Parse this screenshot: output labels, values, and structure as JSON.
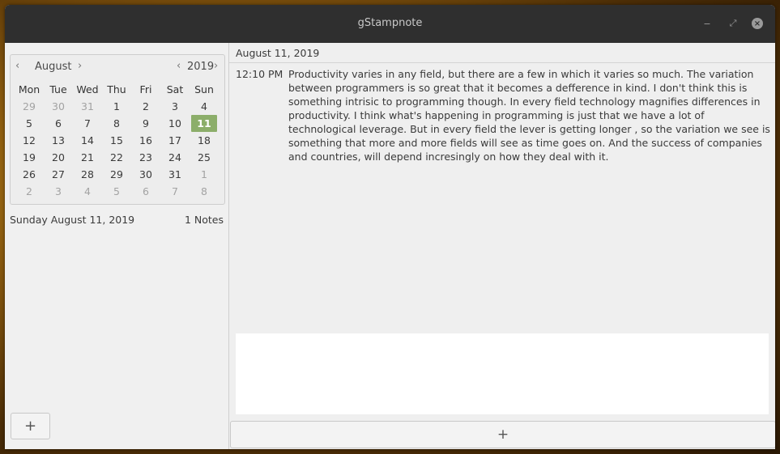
{
  "window": {
    "title": "gStampnote",
    "controls": {
      "minimize": "−",
      "maximize": "⤢",
      "close": "×"
    }
  },
  "calendar": {
    "month": "August",
    "year": "2019",
    "prev": "‹",
    "next": "›",
    "weekdays": [
      "Mon",
      "Tue",
      "Wed",
      "Thu",
      "Fri",
      "Sat",
      "Sun"
    ],
    "days": [
      [
        "29",
        "30",
        "31",
        "1",
        "2",
        "3",
        "4"
      ],
      [
        "5",
        "6",
        "7",
        "8",
        "9",
        "10",
        "11"
      ],
      [
        "12",
        "13",
        "14",
        "15",
        "16",
        "17",
        "18"
      ],
      [
        "19",
        "20",
        "21",
        "22",
        "23",
        "24",
        "25"
      ],
      [
        "26",
        "27",
        "28",
        "29",
        "30",
        "31",
        "1"
      ],
      [
        "2",
        "3",
        "4",
        "5",
        "6",
        "7",
        "8"
      ]
    ],
    "selected_day": "11",
    "selected_color": "#8cae6a"
  },
  "sidebar": {
    "selected_date": "Sunday August 11, 2019",
    "notes_count": "1 Notes",
    "add_label": "+"
  },
  "main": {
    "day_header": "August 11, 2019",
    "note": {
      "time": "12:10 PM",
      "text": "Productivity varies in any field, but there are a few in which it varies so much. The variation between programmers is so great that it becomes a defference in kind. I don't think this is something intrisic to programming though. In every field technology magnifies differences in productivity. I think what's happening in programming is just that we have a lot of technological leverage. But in every field the lever is getting longer , so the variation we see is something that more and more fields will see as time goes on. And the success of companies and countries, will depend incresingly on how they deal with it."
    },
    "add_label": "+"
  }
}
